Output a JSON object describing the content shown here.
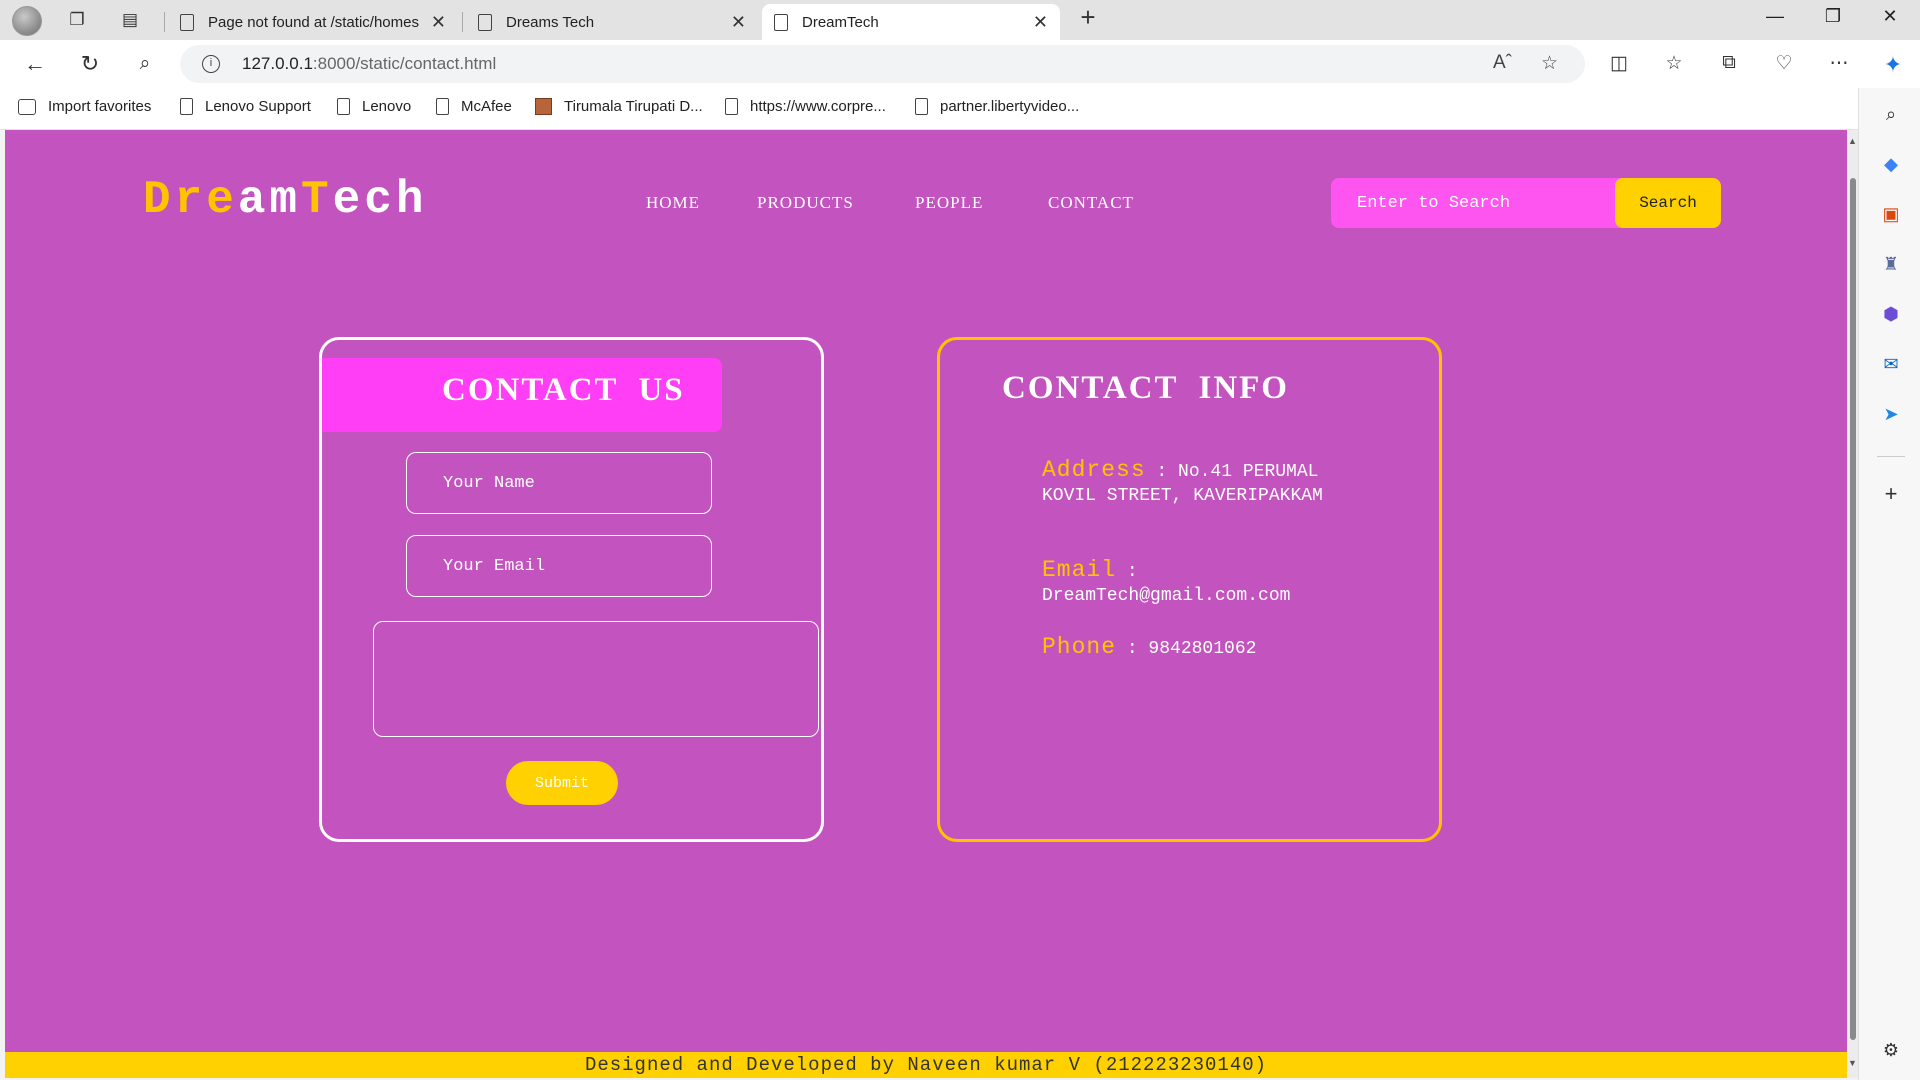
{
  "browser": {
    "tabs": [
      {
        "label": "Page not found at /static/homes",
        "active": false
      },
      {
        "label": "Dreams Tech",
        "active": false
      },
      {
        "label": "DreamTech",
        "active": true
      }
    ],
    "new_tab": "+",
    "url_host": "127.0.0.1",
    "url_rest": ":8000/static/contact.html",
    "favorites": [
      "Import favorites",
      "Lenovo Support",
      "Lenovo",
      "McAfee",
      "Tirumala Tirupati D...",
      "https://www.corpre...",
      "partner.libertyvideo..."
    ]
  },
  "site": {
    "logo_parts": [
      {
        "text": "D",
        "color": "#ffc400"
      },
      {
        "text": "re",
        "color": "#ffc400"
      },
      {
        "text": "am",
        "color": "#ffffff"
      },
      {
        "text": "T",
        "color": "#ffc400"
      },
      {
        "text": "ech",
        "color": "#ffffff"
      }
    ],
    "nav": [
      "HOME",
      "PRODUCTS",
      "PEOPLE",
      "CONTACT"
    ],
    "search": {
      "placeholder": "Enter to Search",
      "button": "Search"
    },
    "contact_us": {
      "title": "CONTACT  US",
      "name_placeholder": "Your Name",
      "email_placeholder": "Your Email",
      "submit": "Submit"
    },
    "contact_info": {
      "title": "CONTACT  INFO",
      "address_key": "Address",
      "address_value": " : No.41 PERUMAL KOVIL STREET, KAVERIPAKKAM",
      "email_key": "Email",
      "email_value": " : DreamTech@gmail.com.com",
      "phone_key": "Phone",
      "phone_value": " : 9842801062"
    },
    "footer": "Designed and Developed by Naveen kumar V (212223230140)"
  },
  "colors": {
    "page_bg": "#c353bf",
    "accent_yellow": "#ffd100",
    "accent_pink": "#ff3ef5"
  }
}
